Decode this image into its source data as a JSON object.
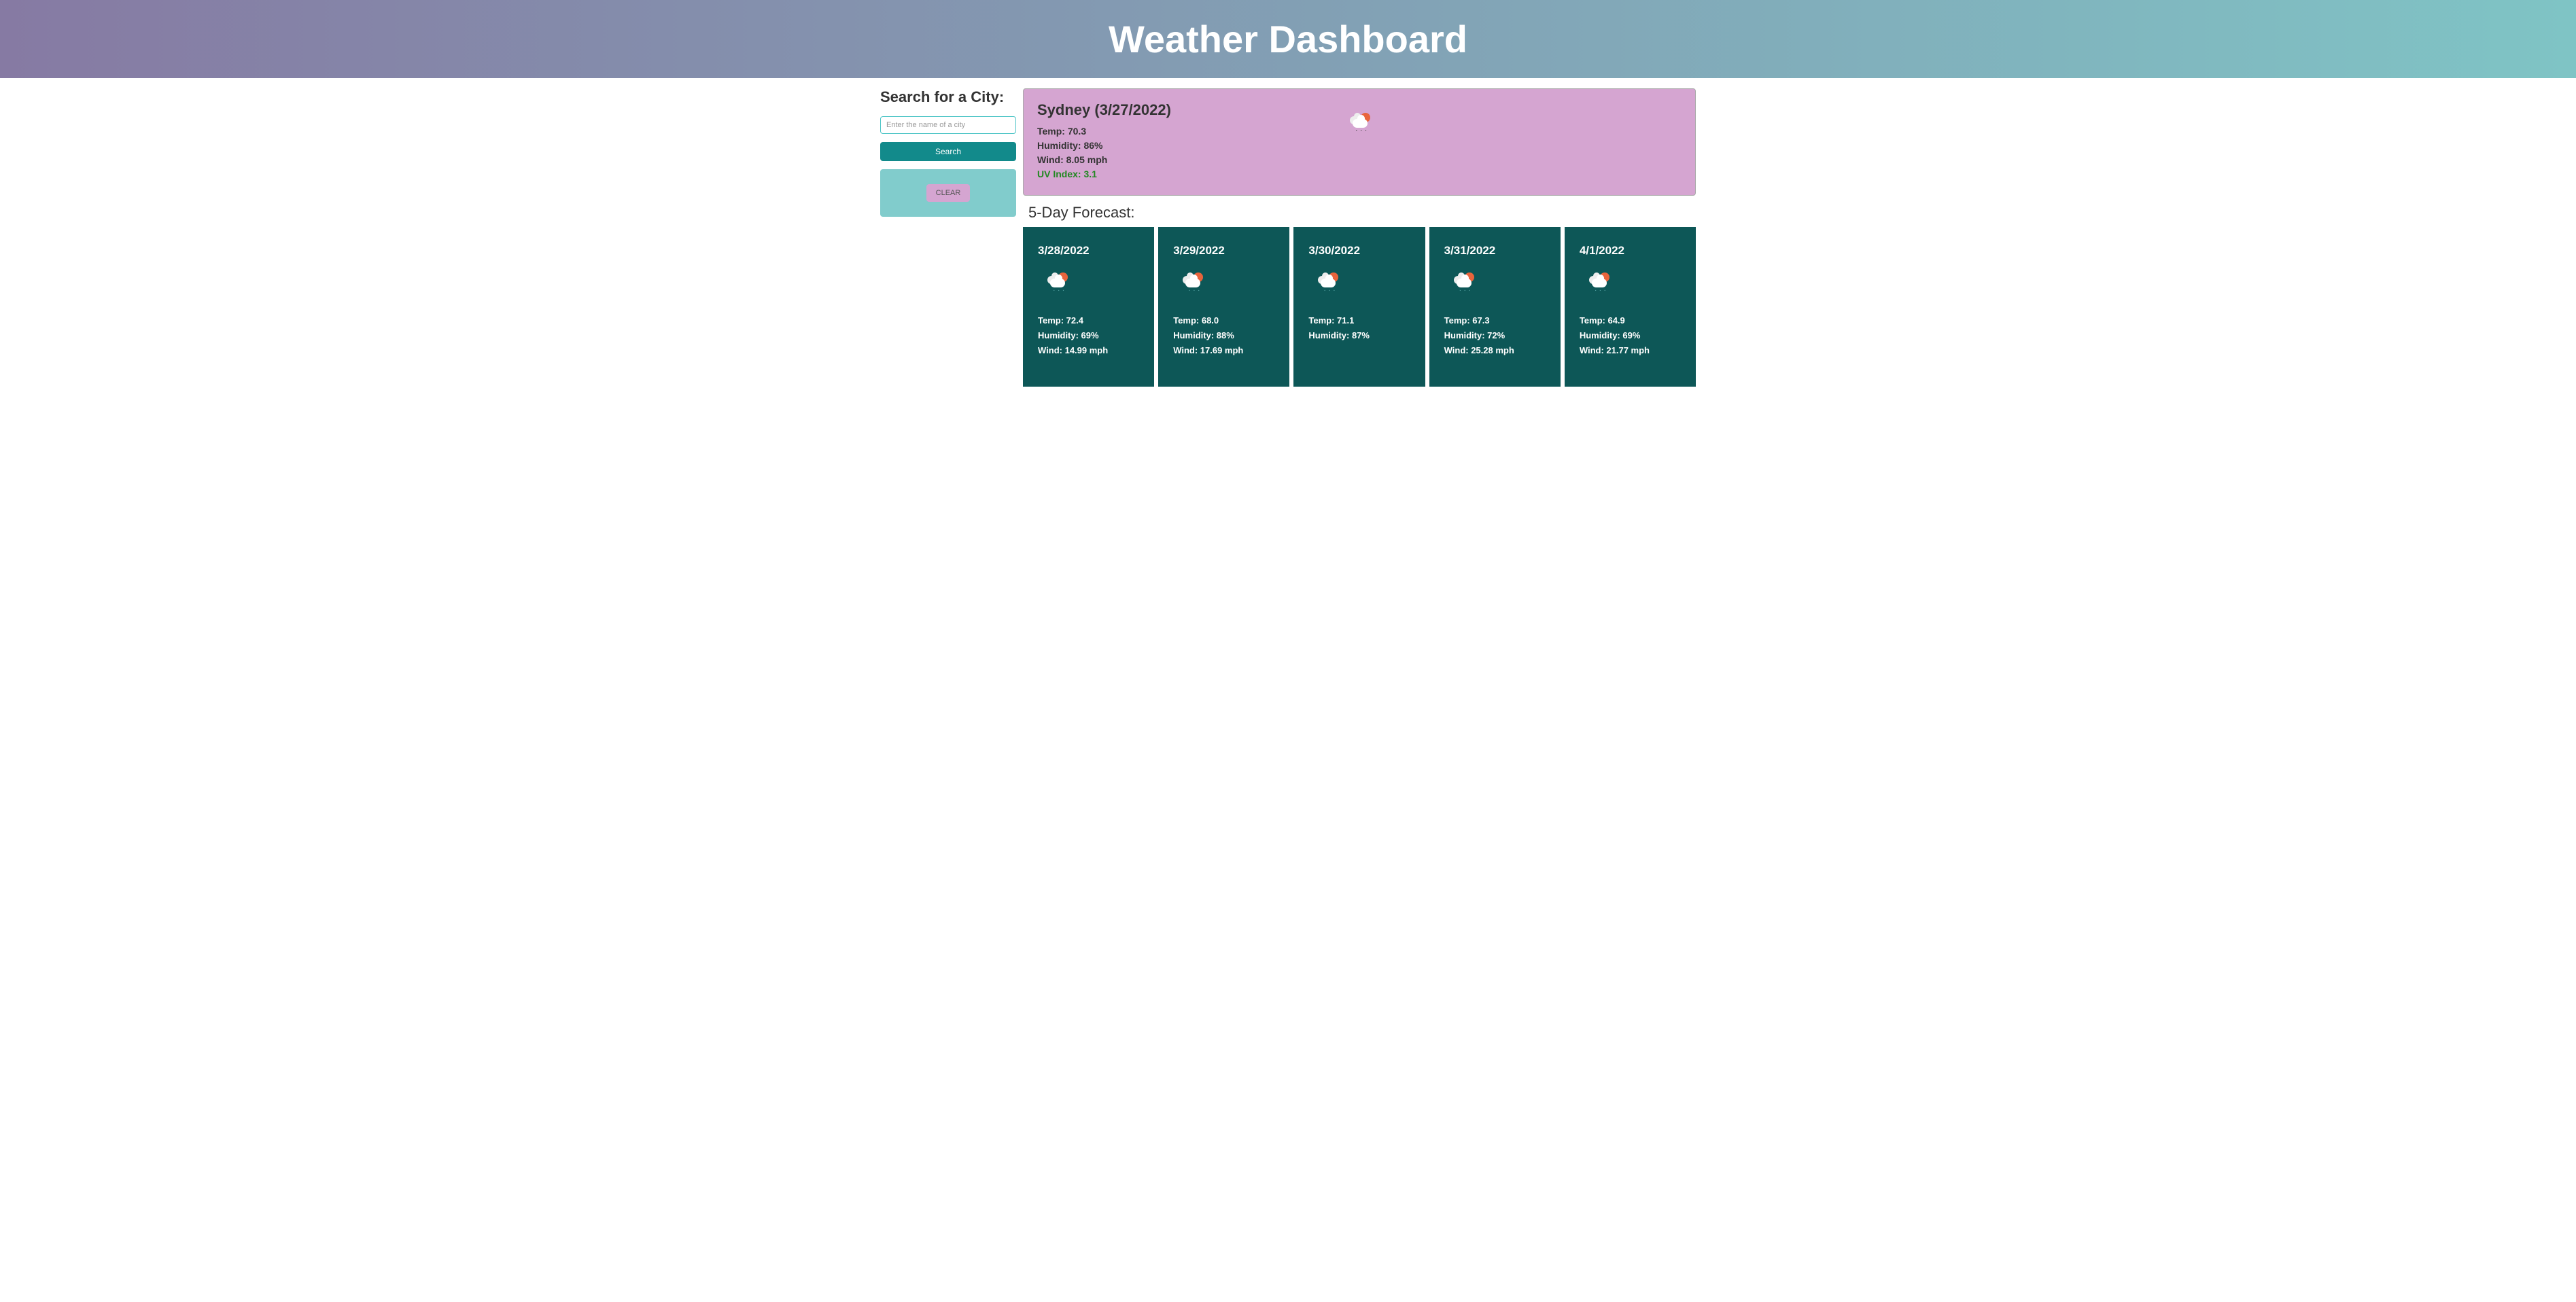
{
  "header": {
    "title": "Weather Dashboard"
  },
  "sidebar": {
    "search_heading": "Search for a City:",
    "search_placeholder": "Enter the name of a city",
    "search_button": "Search",
    "clear_button": "CLEAR"
  },
  "current": {
    "city_date": "Sydney (3/27/2022)",
    "temp": "Temp: 70.3",
    "humidity": "Humidity: 86%",
    "wind": "Wind: 8.05 mph",
    "uv": "UV Index: 3.1",
    "icon": "cloud-sun-rain-icon"
  },
  "forecast": {
    "title": "5-Day Forecast:",
    "days": [
      {
        "date": "3/28/2022",
        "temp": "Temp: 72.4",
        "humidity": "Humidity: 69%",
        "wind": "Wind: 14.99 mph",
        "icon": "cloud-sun-rain-icon"
      },
      {
        "date": "3/29/2022",
        "temp": "Temp: 68.0",
        "humidity": "Humidity: 88%",
        "wind": "Wind: 17.69 mph",
        "icon": "cloud-sun-rain-icon"
      },
      {
        "date": "3/30/2022",
        "temp": "Temp: 71.1",
        "humidity": "Humidity: 87%",
        "wind": "",
        "icon": "cloud-sun-rain-icon"
      },
      {
        "date": "3/31/2022",
        "temp": "Temp: 67.3",
        "humidity": "Humidity: 72%",
        "wind": "Wind: 25.28 mph",
        "icon": "cloud-sun-rain-icon"
      },
      {
        "date": "4/1/2022",
        "temp": "Temp: 64.9",
        "humidity": "Humidity: 69%",
        "wind": "Wind: 21.77 mph",
        "icon": "cloud-sun-rain-icon"
      }
    ]
  }
}
